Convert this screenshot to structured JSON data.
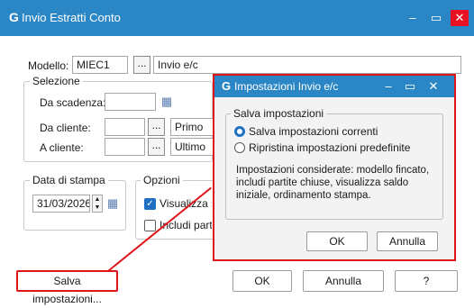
{
  "window": {
    "logo": "G",
    "title": "Invio Estratti Conto",
    "minimize": "–",
    "maximize": "▭",
    "close": "✕"
  },
  "modello": {
    "label": "Modello:",
    "code": "MIEC1",
    "browse": "...",
    "description": "Invio e/c"
  },
  "selezione": {
    "title": "Selezione",
    "scadenza_label": "Da scadenza:",
    "scadenza_value": "",
    "da_cliente_label": "Da cliente:",
    "da_cliente_value": "",
    "da_cliente_browse": "...",
    "da_cliente_desc": "Primo",
    "a_cliente_label": "A cliente:",
    "a_cliente_value": "",
    "a_cliente_browse": "...",
    "a_cliente_desc": "Ultimo"
  },
  "data_stampa": {
    "title": "Data di stampa",
    "value": "31/03/2026"
  },
  "opzioni": {
    "title": "Opzioni",
    "visualizza_label": "Visualizza saldo",
    "visualizza_checked": true,
    "includi_label": "Includi partite",
    "includi_checked": false
  },
  "footer": {
    "salva": "Salva impostazioni...",
    "ok": "OK",
    "annulla": "Annulla",
    "help": "?"
  },
  "dialog": {
    "logo": "G",
    "title": "Impostazioni Invio e/c",
    "minimize": "–",
    "maximize": "▭",
    "close": "✕",
    "group_title": "Salva impostazioni",
    "option1": "Salva impostazioni correnti",
    "option2": "Ripristina impostazioni predefinite",
    "selected_option": "option1",
    "info": "Impostazioni considerate: modello fincato, includi partite chiuse, visualizza saldo iniziale, ordinamento stampa.",
    "ok": "OK",
    "annulla": "Annulla"
  },
  "colors": {
    "titlebar": "#2b86c5",
    "highlight": "#e0151a",
    "accent": "#1f6fc4"
  },
  "icons": {
    "calendar": "calendar-icon",
    "spinner": "spinner-icon",
    "radio": "radio-icon",
    "check": "checkbox-icon"
  }
}
